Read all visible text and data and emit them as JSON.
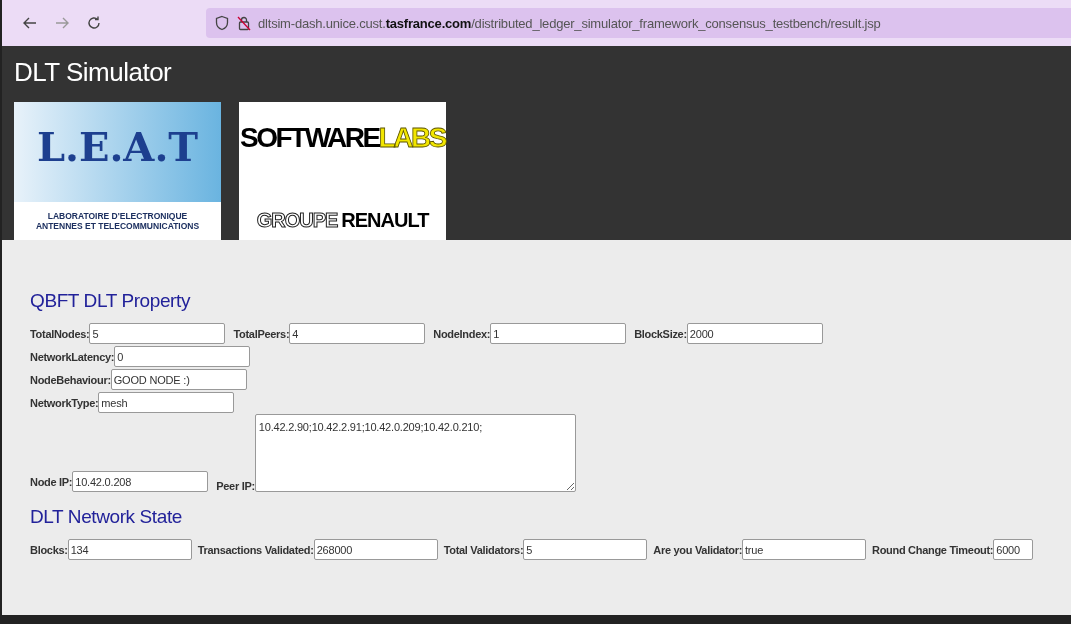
{
  "browser": {
    "url_host": "dltsim-dash.unice.cust.",
    "url_domain": "tasfrance.com",
    "url_path": "/distributed_ledger_simulator_framework_consensus_testbench/result.jsp"
  },
  "header": {
    "title": "DLT Simulator",
    "leat_logo": {
      "letters": "L.E.A.T",
      "line_1": "LABORATOIRE D'ELECTRONIQUE",
      "line_2": "ANTENNES ET TELECOMMUNICATIONS"
    },
    "software_logo": {
      "word_1": "SOFTWARE",
      "word_2": "LABS",
      "word_3": "GROUPE",
      "word_4": "RENAULT"
    }
  },
  "property": {
    "heading": "QBFT DLT Property",
    "rows": [
      [
        {
          "label": "TotalNodes:",
          "value": "5"
        },
        {
          "label": "TotalPeers:",
          "value": "4"
        },
        {
          "label": "NodeIndex:",
          "value": "1"
        },
        {
          "label": "BlockSize:",
          "value": "2000"
        }
      ],
      [
        {
          "label": "NetworkLatency:",
          "value": "0"
        }
      ],
      [
        {
          "label": "NodeBehaviour:",
          "value": "GOOD NODE :)"
        }
      ],
      [
        {
          "label": "NetworkType:",
          "value": "mesh"
        }
      ]
    ],
    "node_ip": {
      "label": "Node IP:",
      "value": "10.42.0.208"
    },
    "peer_ip": {
      "label": "Peer IP:",
      "value": "10.42.2.90;10.42.2.91;10.42.0.209;10.42.0.210;"
    }
  },
  "network_state": {
    "heading": "DLT Network State",
    "fields": [
      {
        "label": "Blocks:",
        "value": "134"
      },
      {
        "label": "Transactions Validated:",
        "value": "268000"
      },
      {
        "label": "Total Validators:",
        "value": "5"
      },
      {
        "label": "Are you Validator:",
        "value": "true"
      },
      {
        "label": "Round Change Timeout:",
        "value": "6000"
      }
    ]
  }
}
